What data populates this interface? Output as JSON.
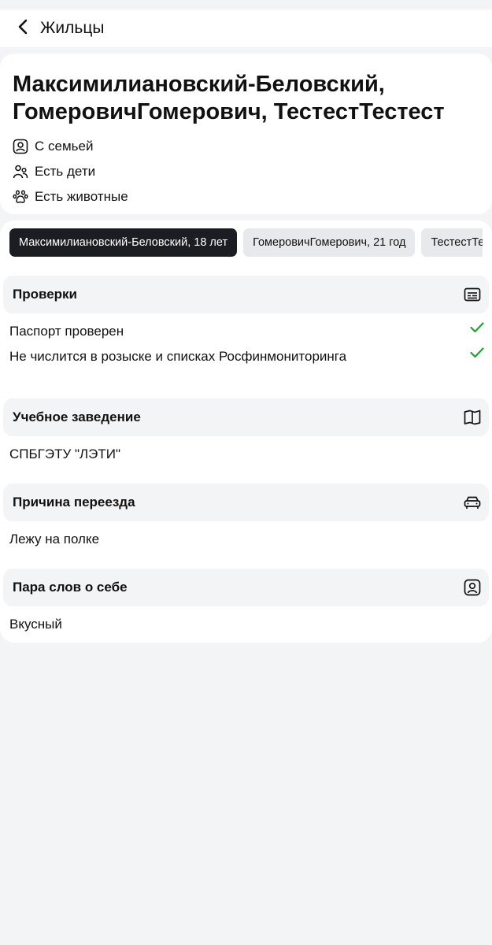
{
  "topbar": {
    "title": "Жильцы",
    "back_icon": "chevron-left-icon"
  },
  "header": {
    "name_line1": "Максимилиановский-Беловский,",
    "name_line2": "ГомеровичГомерович, ТестестТестест",
    "traits": [
      {
        "icon": "person-badge-icon",
        "label": "С семьей"
      },
      {
        "icon": "people-icon",
        "label": "Есть дети"
      },
      {
        "icon": "paw-icon",
        "label": "Есть животные"
      }
    ]
  },
  "tabs": [
    {
      "label": "Максимилиановский-Беловский, 18 лет",
      "active": true
    },
    {
      "label": "ГомеровичГомерович, 21 год",
      "active": false
    },
    {
      "label": "ТестестТестест",
      "active": false
    }
  ],
  "checks": {
    "title": "Проверки",
    "icon": "id-card-icon",
    "items": [
      {
        "label": "Паспорт проверен",
        "status_icon": "check-icon"
      },
      {
        "label": "Не числится в розыске и списках Росфинмониторинга",
        "status_icon": "check-icon"
      }
    ]
  },
  "education": {
    "title": "Учебное заведение",
    "icon": "book-icon",
    "value": "СПБГЭТУ \"ЛЭТИ\""
  },
  "moving": {
    "title": "Причина переезда",
    "icon": "car-icon",
    "value": "Лежу на полке"
  },
  "about": {
    "title": "Пара слов о себе",
    "icon": "person-badge-icon",
    "value": "Вкусный"
  },
  "colors": {
    "accent_check": "#21a038",
    "tab_active_bg": "#1c1d22",
    "page_bg": "#f3f4f6"
  }
}
